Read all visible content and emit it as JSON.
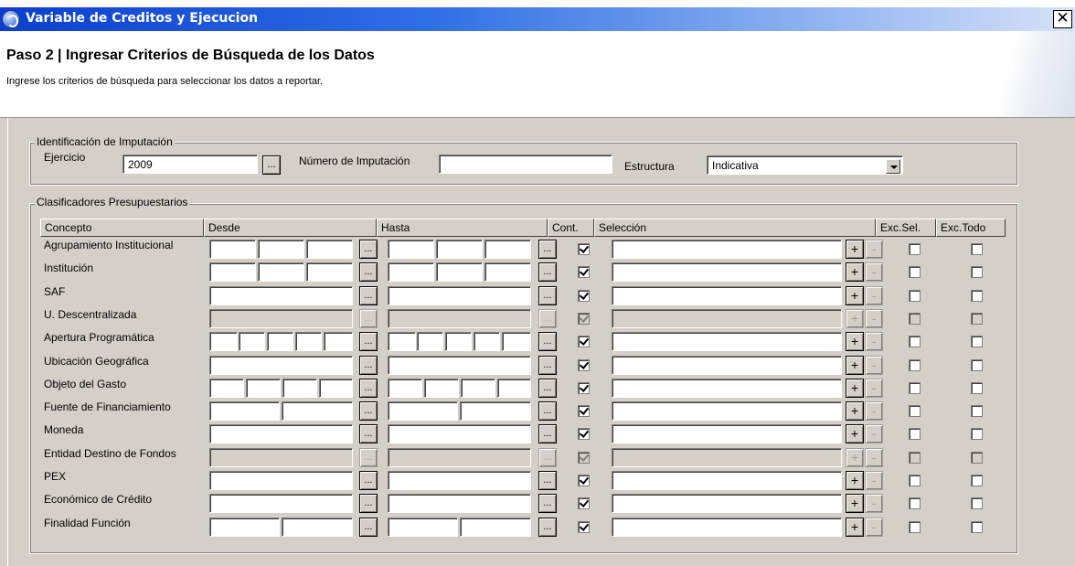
{
  "window": {
    "title": "Variable de Creditos y Ejecucion",
    "close_glyph": "✕"
  },
  "header": {
    "title": "Paso 2 | Ingresar Criterios de Búsqueda de los Datos",
    "subtitle": "Ingrese los criterios de búsqueda para seleccionar los datos a reportar."
  },
  "identificacion": {
    "legend": "Identificación de Imputación",
    "ejercicio_label": "Ejercicio",
    "ejercicio_value": "2009",
    "numero_label": "Número de Imputación",
    "numero_value": "",
    "estructura_label": "Estructura",
    "estructura_value": "Indicativa",
    "browse_glyph": "..."
  },
  "clasificadores": {
    "legend": "Clasificadores Presupuestarios",
    "headers": {
      "concepto": "Concepto",
      "desde": "Desde",
      "hasta": "Hasta",
      "cont": "Cont.",
      "seleccion": "Selección",
      "excsel": "Exc.Sel.",
      "exctodo": "Exc.Todo"
    },
    "glyphs": {
      "browse": "...",
      "plus": "+",
      "minus": "-"
    },
    "rows": [
      {
        "label": "Agrupamiento Institucional",
        "enabled": true,
        "cont": true,
        "exc_sel": false,
        "exc_todo": false
      },
      {
        "label": "Institución",
        "enabled": true,
        "cont": true,
        "exc_sel": false,
        "exc_todo": false
      },
      {
        "label": "SAF",
        "enabled": true,
        "cont": true,
        "exc_sel": false,
        "exc_todo": false
      },
      {
        "label": "U. Descentralizada",
        "enabled": false,
        "cont": true,
        "exc_sel": false,
        "exc_todo": false
      },
      {
        "label": "Apertura Programática",
        "enabled": true,
        "cont": true,
        "exc_sel": false,
        "exc_todo": false
      },
      {
        "label": "Ubicación Geográfica",
        "enabled": true,
        "cont": true,
        "exc_sel": false,
        "exc_todo": false
      },
      {
        "label": "Objeto del Gasto",
        "enabled": true,
        "cont": true,
        "exc_sel": false,
        "exc_todo": false
      },
      {
        "label": "Fuente de Financiamiento",
        "enabled": true,
        "cont": true,
        "exc_sel": false,
        "exc_todo": false
      },
      {
        "label": "Moneda",
        "enabled": true,
        "cont": true,
        "exc_sel": false,
        "exc_todo": false
      },
      {
        "label": "Entidad Destino de Fondos",
        "enabled": false,
        "cont": true,
        "exc_sel": false,
        "exc_todo": false
      },
      {
        "label": "PEX",
        "enabled": true,
        "cont": true,
        "exc_sel": false,
        "exc_todo": false
      },
      {
        "label": "Económico de Crédito",
        "enabled": true,
        "cont": true,
        "exc_sel": false,
        "exc_todo": false
      },
      {
        "label": "Finalidad Función",
        "enabled": true,
        "cont": true,
        "exc_sel": false,
        "exc_todo": false
      }
    ]
  }
}
